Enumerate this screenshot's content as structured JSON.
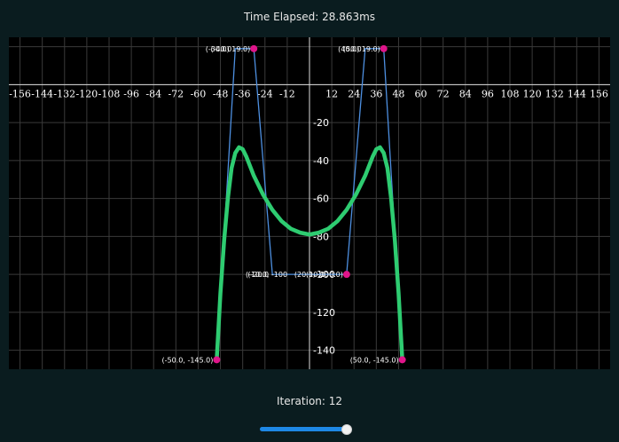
{
  "header": {
    "time_text": "Time Elapsed: 28.863ms"
  },
  "footer": {
    "iteration_text": "Iteration: 12"
  },
  "slider": {
    "value_fraction": 1.0
  },
  "colors": {
    "background": "#0a1c1f",
    "plot_bg": "#000000",
    "grid": "#3a3a3a",
    "axis": "#dcdcdc",
    "curve": "#2ecc71",
    "control_line": "#4d8fe0",
    "point": "#e0158a",
    "slider": "#1e88e5"
  },
  "chart_data": {
    "type": "line",
    "xlim": [
      -162,
      162
    ],
    "ylim": [
      -150,
      25
    ],
    "x_ticks": [
      -156,
      -144,
      -132,
      -120,
      -108,
      -96,
      -84,
      -72,
      -60,
      -48,
      -36,
      -24,
      -12,
      12,
      24,
      36,
      48,
      60,
      72,
      84,
      96,
      108,
      120,
      132,
      144,
      156
    ],
    "y_ticks": [
      -20,
      -40,
      -60,
      -80,
      -100,
      -120,
      -140
    ],
    "control_points": [
      {
        "x": -50,
        "y": -145,
        "label": "(-50.0, -145.0)"
      },
      {
        "x": -40,
        "y": 19,
        "label": "(-40.0"
      },
      {
        "x": -30,
        "y": 19,
        "label": "(-30.0) 19.0)"
      },
      {
        "x": -20,
        "y": -100,
        "label": "(-20.0"
      },
      {
        "x": -10,
        "y": -100,
        "label": "(-10.0, -100"
      },
      {
        "x": 10,
        "y": -100,
        "label": "(10.0"
      },
      {
        "x": 20,
        "y": -100,
        "label": "(20.0, -100.0)"
      },
      {
        "x": 30,
        "y": 19,
        "label": "(50.0"
      },
      {
        "x": 40,
        "y": 19,
        "label": "(40.0) 19.0)"
      },
      {
        "x": 50,
        "y": -145,
        "label": "(50.0, -145.0)"
      }
    ],
    "highlighted_points": [
      {
        "x": -50,
        "y": -145
      },
      {
        "x": -30,
        "y": 19
      },
      {
        "x": 20,
        "y": -100
      },
      {
        "x": 40,
        "y": 19
      },
      {
        "x": 50,
        "y": -145
      }
    ],
    "curve_points": [
      {
        "x": -50,
        "y": -145
      },
      {
        "x": -48,
        "y": -110
      },
      {
        "x": -46,
        "y": -82
      },
      {
        "x": -44,
        "y": -60
      },
      {
        "x": -42,
        "y": -44
      },
      {
        "x": -40,
        "y": -36
      },
      {
        "x": -38,
        "y": -33
      },
      {
        "x": -36,
        "y": -34
      },
      {
        "x": -34,
        "y": -38
      },
      {
        "x": -30,
        "y": -48
      },
      {
        "x": -25,
        "y": -58
      },
      {
        "x": -20,
        "y": -66
      },
      {
        "x": -15,
        "y": -72
      },
      {
        "x": -10,
        "y": -76
      },
      {
        "x": -5,
        "y": -78
      },
      {
        "x": 0,
        "y": -79
      },
      {
        "x": 5,
        "y": -78
      },
      {
        "x": 10,
        "y": -76
      },
      {
        "x": 15,
        "y": -72
      },
      {
        "x": 20,
        "y": -66
      },
      {
        "x": 25,
        "y": -58
      },
      {
        "x": 30,
        "y": -48
      },
      {
        "x": 34,
        "y": -38
      },
      {
        "x": 36,
        "y": -34
      },
      {
        "x": 38,
        "y": -33
      },
      {
        "x": 40,
        "y": -36
      },
      {
        "x": 42,
        "y": -44
      },
      {
        "x": 44,
        "y": -60
      },
      {
        "x": 46,
        "y": -82
      },
      {
        "x": 48,
        "y": -110
      },
      {
        "x": 50,
        "y": -145
      }
    ]
  }
}
